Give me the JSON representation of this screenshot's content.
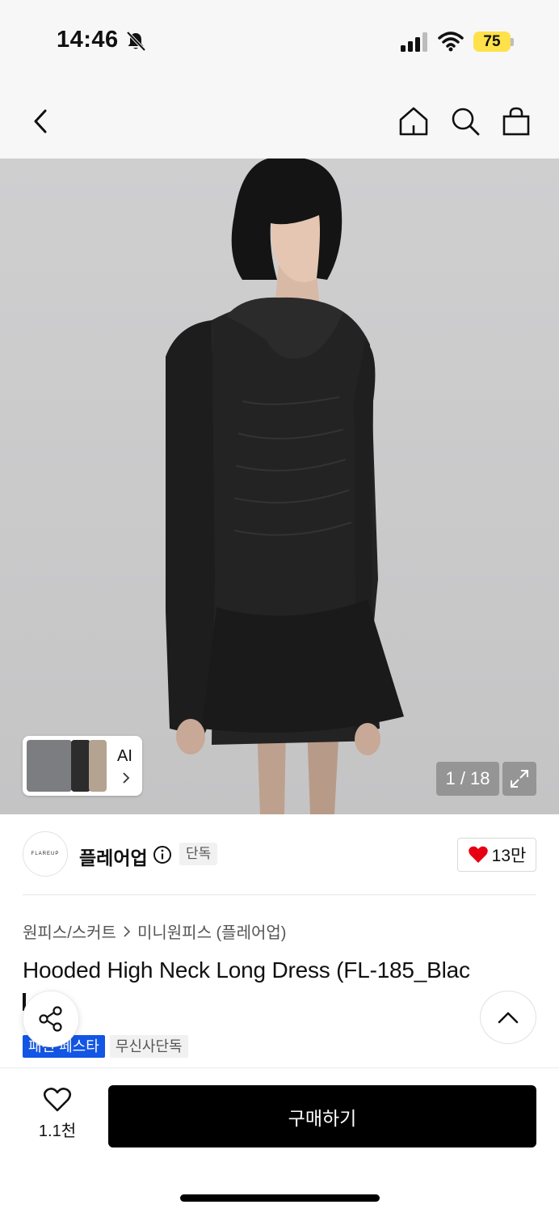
{
  "status": {
    "time": "14:46",
    "battery": "75",
    "battery_color": "#ffe14a"
  },
  "nav": {
    "back_icon": "chevron-left-icon",
    "home_icon": "home-icon",
    "search_icon": "search-icon",
    "cart_icon": "shopping-bag-icon"
  },
  "gallery": {
    "thumbnail_label": "AI",
    "counter": "1 / 18"
  },
  "brand": {
    "logo_text": "FLAREUP",
    "name": "플레어업",
    "tag": "단독",
    "likes": "13만",
    "heart_color": "#e60012"
  },
  "breadcrumb": {
    "category": "원피스/스커트",
    "subcategory": "미니원피스 (플레어업)"
  },
  "product": {
    "title": "Hooded High Neck Long Dress (FL-185_Blac"
  },
  "badges": {
    "festival": "패션 페스타",
    "exclusive": "무신사단독",
    "festival_color": "#1356e6"
  },
  "bottom": {
    "wish_count": "1.1천",
    "buy_label": "구매하기"
  }
}
